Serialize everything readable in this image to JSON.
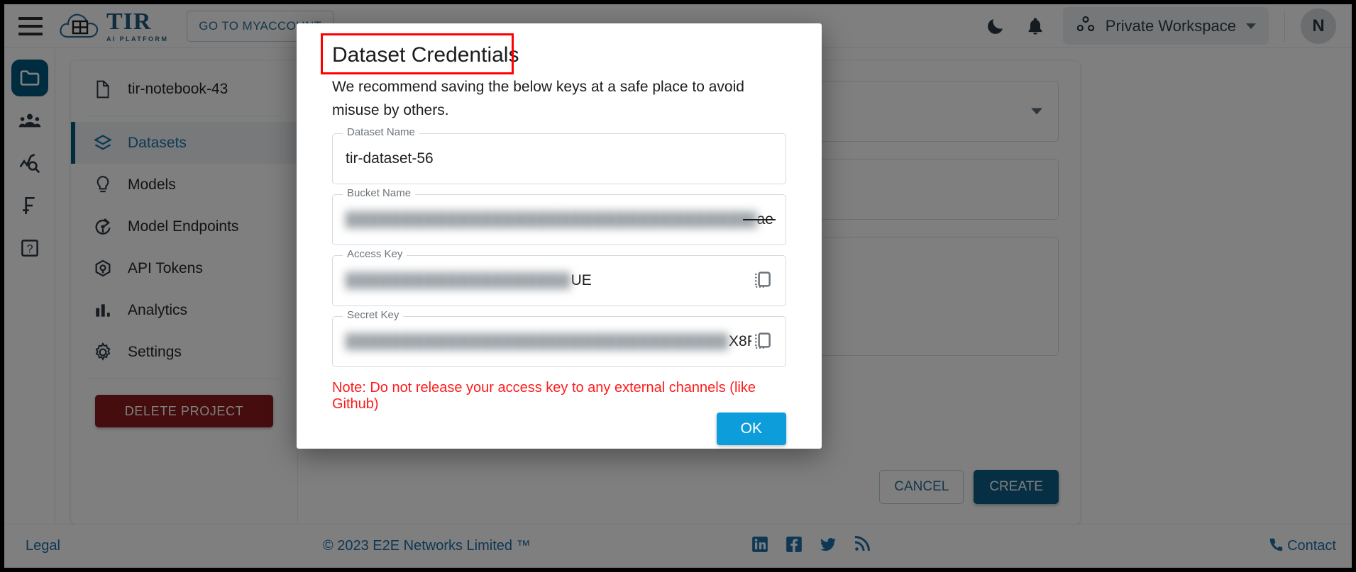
{
  "header": {
    "menu_icon": "hamburger-icon",
    "logo_text": "TIR",
    "logo_subtext": "AI PLATFORM",
    "logo_cloud_label": "E2E Cloud",
    "goto_account_label": "GO TO MYACCOUNT",
    "dark_mode_icon": "moon-icon",
    "notifications_icon": "bell-icon",
    "workspace_label": "Private Workspace",
    "workspace_icon": "workspace-nodes-icon",
    "avatar_initial": "N"
  },
  "rail": {
    "items": [
      {
        "icon": "folder-icon",
        "name": "projects",
        "active": true
      },
      {
        "icon": "users-icon",
        "name": "team",
        "active": false
      },
      {
        "icon": "monitoring-icon",
        "name": "monitoring",
        "active": false
      },
      {
        "icon": "billing-icon",
        "name": "billing",
        "active": false
      },
      {
        "icon": "help-icon",
        "name": "help",
        "active": false
      }
    ]
  },
  "sidebar": {
    "items": [
      {
        "label": "tir-notebook-43",
        "icon": "file-icon",
        "active": false
      },
      {
        "label": "Datasets",
        "icon": "layers-icon",
        "active": true
      },
      {
        "label": "Models",
        "icon": "bulb-icon",
        "active": false
      },
      {
        "label": "Model Endpoints",
        "icon": "endpoint-icon",
        "active": false
      },
      {
        "label": "API Tokens",
        "icon": "cube-icon",
        "active": false
      },
      {
        "label": "Analytics",
        "icon": "bar-chart-icon",
        "active": false
      },
      {
        "label": "Settings",
        "icon": "gear-icon",
        "active": false
      }
    ],
    "delete_project_label": "DELETE PROJECT"
  },
  "content": {
    "cancel_label": "CANCEL",
    "create_label": "CREATE"
  },
  "modal": {
    "title": "Dataset Credentials",
    "description": "We recommend saving the below keys at a safe place to avoid misuse by others.",
    "fields": [
      {
        "label": "Dataset Name",
        "value": "tir-dataset-56",
        "redacted": "",
        "copy": false
      },
      {
        "label": "Bucket Name",
        "value": "ae",
        "redacted": "██████████████████████████████████████",
        "copy": false
      },
      {
        "label": "Access Key",
        "value": "UE",
        "redacted": "████████████████████",
        "copy": true
      },
      {
        "label": "Secret Key",
        "value": "X8F",
        "redacted": "█████████████████████████████████████████",
        "copy": true
      }
    ],
    "note": "Note: Do not release your access key to any external channels (like Github)",
    "ok_label": "OK",
    "copy_icon": "copy-icon",
    "title_highlight_color": "#ff0000",
    "note_color": "#ff1a1a",
    "ok_button_color": "#0d9ddb"
  },
  "footer": {
    "legal": "Legal",
    "copyright": "© 2023 E2E Networks Limited ™",
    "social": [
      "linkedin-icon",
      "facebook-icon",
      "twitter-icon",
      "rss-icon"
    ],
    "contact": "Contact",
    "contact_icon": "phone-icon"
  },
  "colors": {
    "brand_blue": "#00587f",
    "accent_blue": "#0d9ddb",
    "danger_red": "#8b1a1a",
    "link_blue": "#1b6ea8"
  }
}
